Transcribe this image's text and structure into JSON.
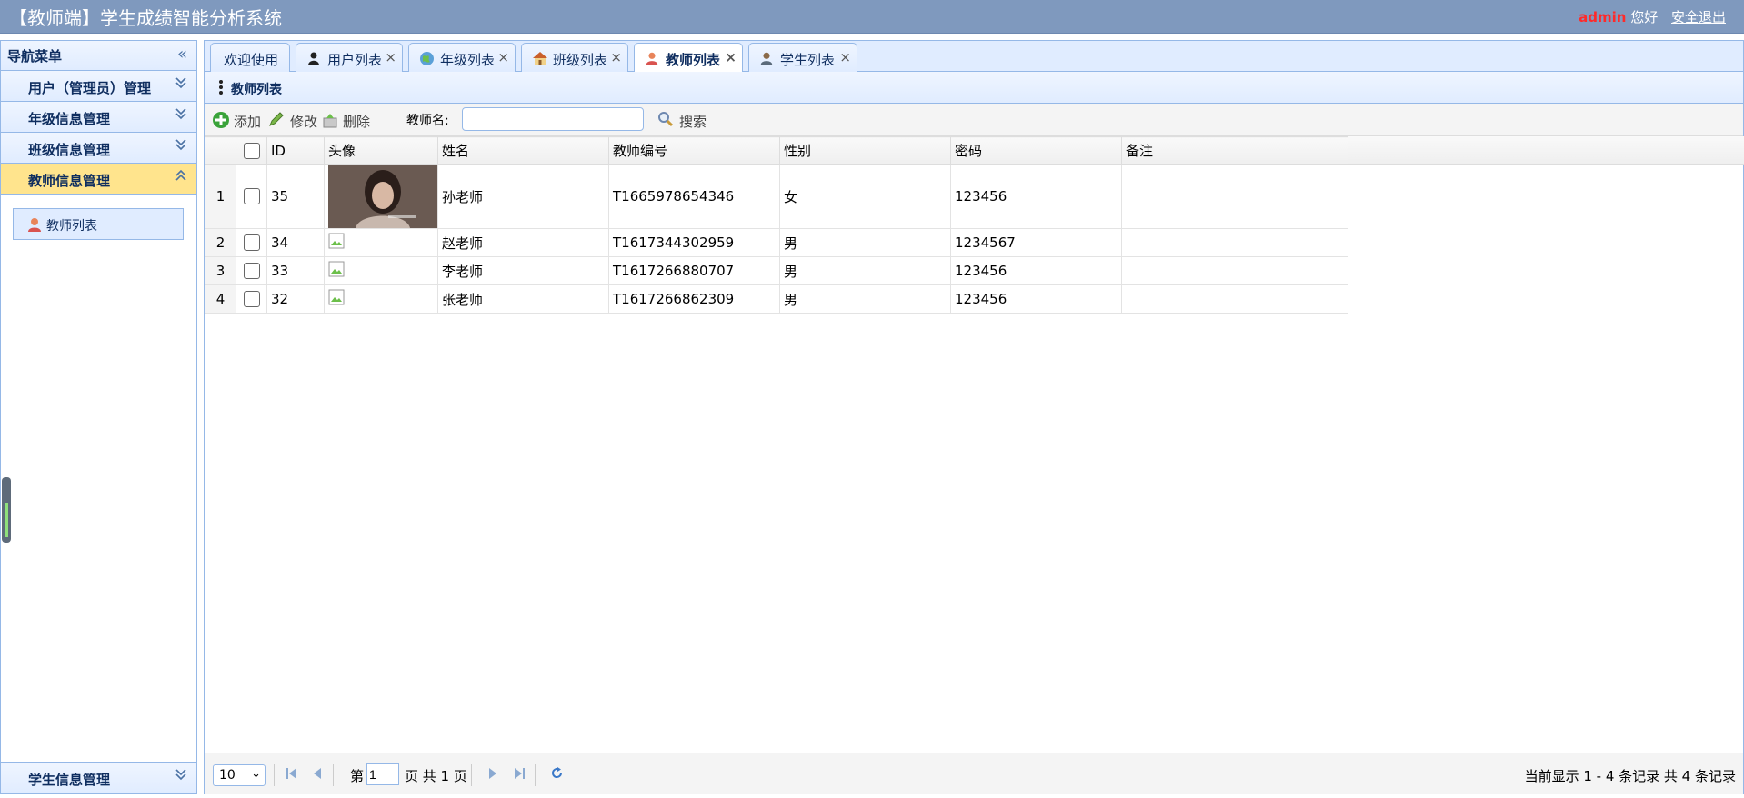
{
  "app": {
    "title": "【教师端】学生成绩智能分析系统",
    "user": "admin",
    "greeting": "您好",
    "logout": "安全退出"
  },
  "sidebar": {
    "header": "导航菜单",
    "groups": [
      {
        "label": "用户（管理员）管理"
      },
      {
        "label": "年级信息管理"
      },
      {
        "label": "班级信息管理"
      },
      {
        "label": "教师信息管理"
      },
      {
        "label": "学生信息管理"
      }
    ],
    "active_item": "教师列表"
  },
  "tabs": [
    {
      "label": "欢迎使用"
    },
    {
      "label": "用户列表"
    },
    {
      "label": "年级列表"
    },
    {
      "label": "班级列表"
    },
    {
      "label": "教师列表"
    },
    {
      "label": "学生列表"
    }
  ],
  "panel": {
    "title": "教师列表"
  },
  "toolbar": {
    "add": "添加",
    "edit": "修改",
    "delete": "删除",
    "search_label": "教师名:",
    "search_value": "",
    "search_button": "搜索"
  },
  "table": {
    "columns": [
      "ID",
      "头像",
      "姓名",
      "教师编号",
      "性别",
      "密码",
      "备注"
    ],
    "rows": [
      {
        "rn": "1",
        "id": "35",
        "name": "孙老师",
        "code": "T1665978654346",
        "gender": "女",
        "password": "123456",
        "note": ""
      },
      {
        "rn": "2",
        "id": "34",
        "name": "赵老师",
        "code": "T1617344302959",
        "gender": "男",
        "password": "1234567",
        "note": ""
      },
      {
        "rn": "3",
        "id": "33",
        "name": "李老师",
        "code": "T1617266880707",
        "gender": "男",
        "password": "123456",
        "note": ""
      },
      {
        "rn": "4",
        "id": "32",
        "name": "张老师",
        "code": "T1617266862309",
        "gender": "男",
        "password": "123456",
        "note": ""
      }
    ]
  },
  "pager": {
    "page_size": "10",
    "page_prefix": "第",
    "page": "1",
    "page_suffix": "页 共 1 页",
    "info": "当前显示 1 - 4 条记录 共 4 条记录"
  }
}
